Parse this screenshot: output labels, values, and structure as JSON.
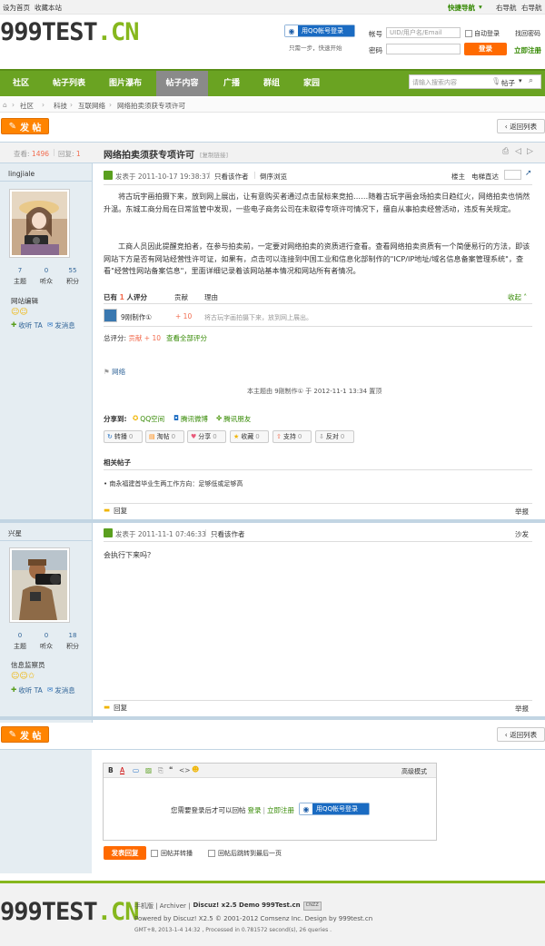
{
  "topbar": {
    "set_home": "设为首页",
    "bookmark": "收藏本站",
    "quick_nav": "快捷导航",
    "right_nav1": "右导航",
    "right_nav2": "右导航"
  },
  "header": {
    "logo_a": "999TEST",
    "logo_b": ".CN",
    "qq_login": "用QQ帐号登录",
    "qq_hint": "只需一步，快速开始",
    "account_label": "帐号",
    "account_placeholder": "UID/用户名/Email",
    "auto_login": "自动登录",
    "forgot": "找回密码",
    "password_label": "密码",
    "login_btn": "登录",
    "register": "立即注册"
  },
  "nav": {
    "items": [
      "社区",
      "帖子列表",
      "图片瀑布",
      "帖子内容",
      "广播",
      "群组",
      "家园"
    ],
    "search_placeholder": "请输入搜索内容",
    "search_scope": "帖子"
  },
  "breadcrumb": {
    "items": [
      "社区",
      "科技",
      "互联网络",
      "网络拍卖须获专项许可"
    ]
  },
  "toolbar": {
    "post_btn": "发 帖",
    "back_btn": "返回列表"
  },
  "thread": {
    "views_label": "查看:",
    "views": "1496",
    "replies_label": "回复:",
    "replies": "1",
    "title": "网络拍卖须获专项许可",
    "copy_link": "[复制链接]"
  },
  "post1": {
    "author": "lingjiale",
    "stats": [
      {
        "num": "7",
        "label": "主题"
      },
      {
        "num": "0",
        "label": "听众"
      },
      {
        "num": "55",
        "label": "积分"
      }
    ],
    "rank": "网站编辑",
    "follow": "收听 TA",
    "message": "发消息",
    "posted_at": "发表于 2011-10-17 19:38:37",
    "only_author": "只看该作者",
    "reverse": "倒序浏览",
    "floor": "楼主",
    "elevator": "电梯直达",
    "para1": "将古玩字画拍摄下来，放到网上展出，让有意购买者通过点击鼠标来竞拍……随着古玩字画会场拍卖日趋红火，网络拍卖也悄然升温。东城工商分局在日常监管中发现，一些电子商务公司在未取得专项许可情况下，擅自从事拍卖经营活动，违反有关规定。",
    "para2": "工商人员因此提醒竞拍者，在参与拍卖前，一定要对网络拍卖的资质进行查看。查看网络拍卖资质有一个简便易行的方法，即该网站下方是否有网站经营性许可证，如果有，点击可以连接到中国工业和信息化部制作的\"ICP/IP地址/域名信息备案管理系统\"，查看\"经营性网站备案信息\"，里面详细记录着该网站基本情况和网站所有者情况。",
    "rate_prefix": "已有",
    "rate_count": "1",
    "rate_suffix": "人评分",
    "rate_col_contrib": "贡献",
    "rate_col_reason": "理由",
    "rate_collapse": "收起",
    "rater": "9刚制作①",
    "rate_value": "+ 10",
    "rate_reason": "将古玩字画拍摄下来，放到网上展出。",
    "total_label": "总评分:",
    "total_value": "贡献 + 10",
    "view_all_ratings": "查看全部评分",
    "tag": "网络",
    "edit_note": "本主题由 9刚制作① 于 2012-11-1 13:34 置顶",
    "share_label": "分享到:",
    "share_targets": [
      "QQ空间",
      "腾讯微博",
      "腾讯朋友"
    ],
    "actions": [
      {
        "label": "转播",
        "count": "0"
      },
      {
        "label": "淘帖",
        "count": "0"
      },
      {
        "label": "分享",
        "count": "0"
      },
      {
        "label": "收藏",
        "count": "0"
      },
      {
        "label": "支持",
        "count": "0"
      },
      {
        "label": "反对",
        "count": "0"
      }
    ],
    "related_title": "相关帖子",
    "related_item": "• 南永福建首毕业生两工作方向：足够低或足够高",
    "reply": "回复",
    "report": "举报"
  },
  "post2": {
    "author": "兴星",
    "stats": [
      {
        "num": "0",
        "label": "主题"
      },
      {
        "num": "0",
        "label": "听众"
      },
      {
        "num": "18",
        "label": "积分"
      }
    ],
    "rank": "信息监察员",
    "follow": "收听 TA",
    "message": "发消息",
    "posted_at": "发表于 2011-11-1 07:46:33",
    "only_author": "只看该作者",
    "floor": "沙发",
    "content": "会执行下来吗？",
    "reply": "回复",
    "report": "举报"
  },
  "editor": {
    "advanced": "高级模式",
    "login_prompt": "您需要登录后才可以回帖",
    "login": "登录",
    "register": "立即注册",
    "qq_login": "用QQ帐号登录",
    "submit": "发表回复",
    "opt1": "回帖并转播",
    "opt2": "回帖后跳转到最后一页"
  },
  "footer": {
    "logo_a": "999TEST",
    "logo_b": ".CN",
    "links": "手机版 | Archiver |",
    "brand": "Discuz! x2.5 Demo 999Test.cn",
    "powered": "Powered by Discuz! X2.5 © 2001-2012 Comsenz Inc. Design by 999test.cn",
    "gmt": "GMT+8, 2013-1-4 14:32 , Processed in 0.781572 second(s), 26 queries ."
  },
  "colors": {
    "nav_green": "#6aa322",
    "orange": "#ff8400",
    "side_blue": "#e5edf2"
  }
}
